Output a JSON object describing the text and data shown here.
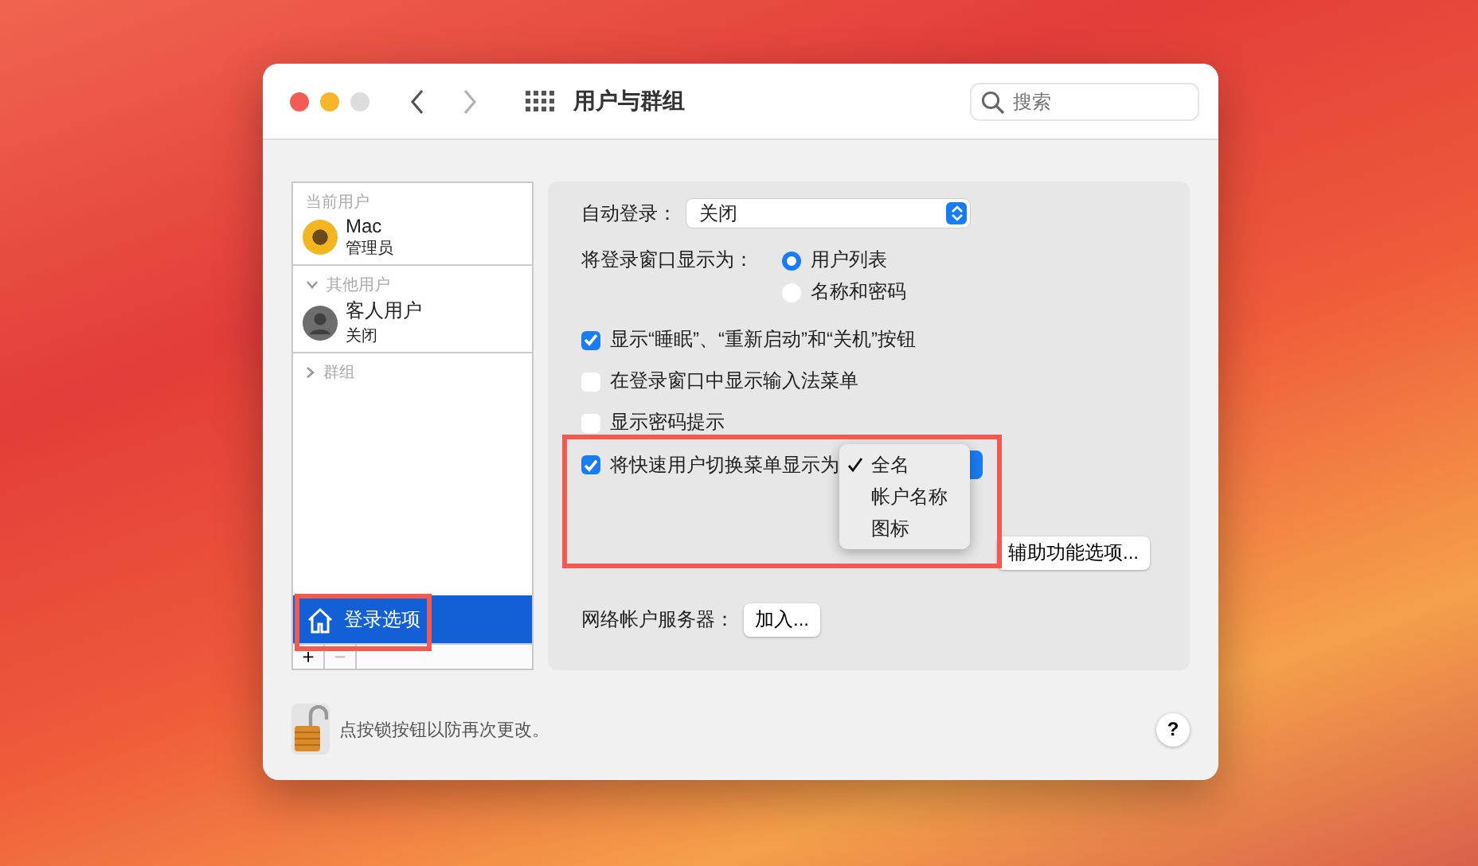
{
  "window": {
    "title": "用户与群组",
    "forward_enabled": false,
    "search": {
      "placeholder": "搜索"
    }
  },
  "sidebar": {
    "sections": [
      {
        "heading": "当前用户",
        "users": [
          {
            "name": "Mac",
            "role": "管理员",
            "kind": "photo"
          }
        ]
      },
      {
        "heading": "其他用户",
        "expanded": true,
        "users": [
          {
            "name": "客人用户",
            "role": "关闭",
            "kind": "generic"
          }
        ]
      },
      {
        "heading": "群组",
        "expanded": false
      }
    ],
    "items": [
      {
        "label": "登录选项",
        "selected": true
      }
    ],
    "buttons": [
      {
        "label": "+",
        "disabled": false
      },
      {
        "label": "−",
        "disabled": true
      }
    ]
  },
  "settings": {
    "auto_login": {
      "label": "自动登录：",
      "value": "关闭"
    },
    "login_window": {
      "label": "将登录窗口显示为：",
      "options": [
        {
          "label": "用户列表",
          "selected": true
        },
        {
          "label": "名称和密码",
          "selected": false
        }
      ]
    },
    "checkboxes": [
      {
        "label": "显示“睡眠”、“重新启动”和“关机”按钮",
        "checked": true
      },
      {
        "label": "在登录窗口中显示输入法菜单",
        "checked": false
      },
      {
        "label": "显示密码提示",
        "checked": false
      }
    ],
    "fast_switch": {
      "label": "将快速用户切换菜单显示为",
      "checked": true,
      "menu": [
        {
          "label": "全名",
          "selected": true
        },
        {
          "label": "帐户名称",
          "selected": false
        },
        {
          "label": "图标",
          "selected": false
        }
      ]
    },
    "accessibility_button": "辅助功能选项...",
    "network": {
      "label": "网络帐户服务器：",
      "button": "加入..."
    }
  },
  "footer": {
    "lock_text": "点按锁按钮以防再次更改。",
    "help": "?"
  }
}
